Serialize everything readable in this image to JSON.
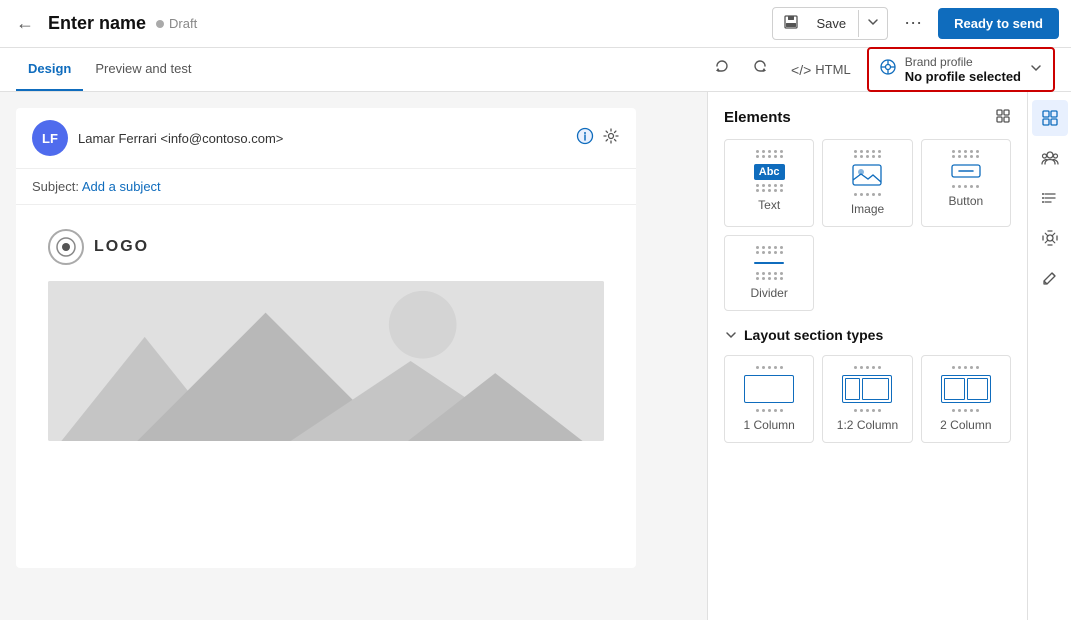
{
  "topBar": {
    "backLabel": "←",
    "title": "Enter name",
    "draftLabel": "Draft",
    "saveLabel": "Save",
    "moreLabel": "⋯",
    "readyLabel": "Ready to send"
  },
  "subNav": {
    "tabs": [
      {
        "label": "Design",
        "active": true
      },
      {
        "label": "Preview and test",
        "active": false
      }
    ],
    "undoLabel": "↺",
    "redoLabel": "↻",
    "htmlLabel": "HTML"
  },
  "brandProfile": {
    "title": "Brand profile",
    "value": "No profile selected",
    "iconLabel": "⚙"
  },
  "email": {
    "avatarInitials": "LF",
    "senderName": "Lamar Ferrari <info@contoso.com>",
    "subjectLabel": "Subject:",
    "subjectPlaceholder": "Add a subject",
    "logoText": "LOGO",
    "bodyPlaceholder": ""
  },
  "elementsPanel": {
    "title": "Elements",
    "elements": [
      {
        "label": "Text",
        "icon": "text"
      },
      {
        "label": "Image",
        "icon": "image"
      },
      {
        "label": "Button",
        "icon": "button"
      },
      {
        "label": "Divider",
        "icon": "divider"
      }
    ],
    "layoutTitle": "Layout section types",
    "layouts": [
      {
        "label": "1 Column",
        "type": "1col"
      },
      {
        "label": "1:2 Column",
        "type": "12col"
      },
      {
        "label": "2 Column",
        "type": "2col"
      }
    ]
  },
  "sidebar": {
    "icons": [
      {
        "name": "layout-icon",
        "symbol": "⊞",
        "active": true
      },
      {
        "name": "people-icon",
        "symbol": "⚇",
        "active": false
      },
      {
        "name": "list-icon",
        "symbol": "≡",
        "active": false
      },
      {
        "name": "personalize-icon",
        "symbol": "⚙",
        "active": false
      },
      {
        "name": "pen-icon",
        "symbol": "✏",
        "active": false
      }
    ]
  }
}
